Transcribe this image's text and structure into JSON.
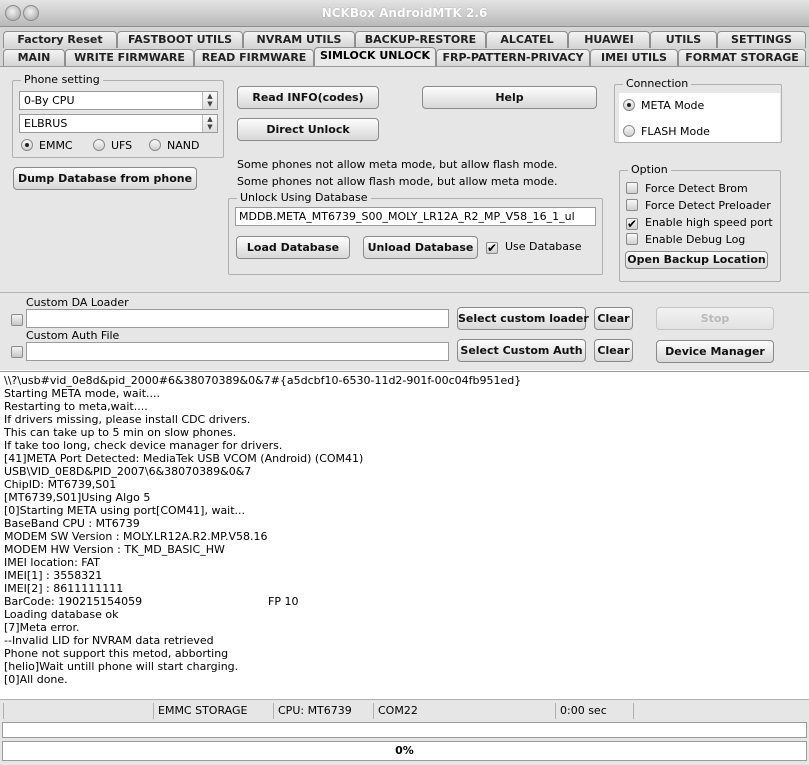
{
  "window": {
    "title": "NCKBox AndroidMTK 2.6"
  },
  "tabs_row1": [
    "Factory Reset",
    "FASTBOOT UTILS",
    "NVRAM UTILS",
    "BACKUP-RESTORE",
    "ALCATEL",
    "HUAWEI",
    "UTILS",
    "SETTINGS"
  ],
  "tabs_row2": [
    "MAIN",
    "WRITE FIRMWARE",
    "READ FIRMWARE",
    "SIMLOCK UNLOCK",
    "FRP-PATTERN-PRIVACY",
    "IMEI UTILS",
    "FORMAT STORAGE"
  ],
  "active_tab": "SIMLOCK UNLOCK",
  "phone_setting": {
    "title": "Phone setting",
    "cpu_select": "0-By CPU",
    "model_select": "ELBRUS",
    "storage_options": [
      "EMMC",
      "UFS",
      "NAND"
    ],
    "storage_selected": "EMMC"
  },
  "buttons": {
    "read_info": "Read INFO(codes)",
    "help": "Help",
    "direct_unlock": "Direct Unlock",
    "dump_database": "Dump Database from phone",
    "load_database": "Load Database",
    "unload_database": "Unload Database",
    "open_backup": "Open Backup Location",
    "select_custom_loader": "Select custom loader",
    "select_custom_auth": "Select Custom Auth",
    "clear": "Clear",
    "stop": "Stop",
    "device_manager": "Device Manager"
  },
  "info_lines": [
    "Some phones not allow meta mode, but allow flash mode.",
    "Some phones not allow flash mode, but allow meta mode."
  ],
  "unlock_db": {
    "title": "Unlock Using Database",
    "path": "MDDB.META_MT6739_S00_MOLY_LR12A_R2_MP_V58_16_1_ul",
    "use_database_label": "Use Database",
    "use_database_checked": true
  },
  "connection": {
    "title": "Connection",
    "options": [
      "META Mode",
      "FLASH Mode"
    ],
    "selected": "META Mode"
  },
  "option": {
    "title": "Option",
    "items": [
      {
        "label": "Force Detect Brom",
        "checked": false
      },
      {
        "label": "Force Detect Preloader",
        "checked": false
      },
      {
        "label": "Enable high speed port",
        "checked": true
      },
      {
        "label": "Enable Debug Log",
        "checked": false
      }
    ]
  },
  "custom": {
    "da_label": "Custom DA Loader",
    "da_value": "",
    "auth_label": "Custom Auth File",
    "auth_value": ""
  },
  "log_lines": [
    "\\\\?\\usb#vid_0e8d&pid_2000#6&38070389&0&7#{a5dcbf10-6530-11d2-901f-00c04fb951ed}",
    "Starting META mode, wait....",
    "Restarting to meta,wait....",
    "If drivers missing, please install CDC drivers.",
    "This can take up to 5 min on slow phones.",
    "If take too long, check device manager for drivers.",
    "[41]META Port Detected: MediaTek USB VCOM (Android) (COM41)",
    "USB\\VID_0E8D&PID_2007\\6&38070389&0&7",
    "ChipID: MT6739,S01",
    "[MT6739,S01]Using Algo 5",
    "[0]Starting META using port[COM41], wait...",
    "BaseBand CPU : MT6739",
    "MODEM SW Version : MOLY.LR12A.R2.MP.V58.16",
    "MODEM HW Version : TK_MD_BASIC_HW",
    "IMEI location: FAT",
    "IMEI[1] : 3558321",
    "IMEI[2] : 8611111111",
    "BarCode: 190215154059                                    FP 10",
    "Loading database ok",
    "[7]Meta error.",
    "--Invalid LID for NVRAM data retrieved",
    "Phone not support this metod, abborting",
    "[helio]Wait untill phone will start charging.",
    "[0]All done."
  ],
  "status": {
    "storage": "EMMC STORAGE",
    "cpu": "CPU: MT6739",
    "com": "COM22",
    "time": "0:00 sec"
  },
  "progress": {
    "value_percent": 0,
    "label": "0%"
  }
}
